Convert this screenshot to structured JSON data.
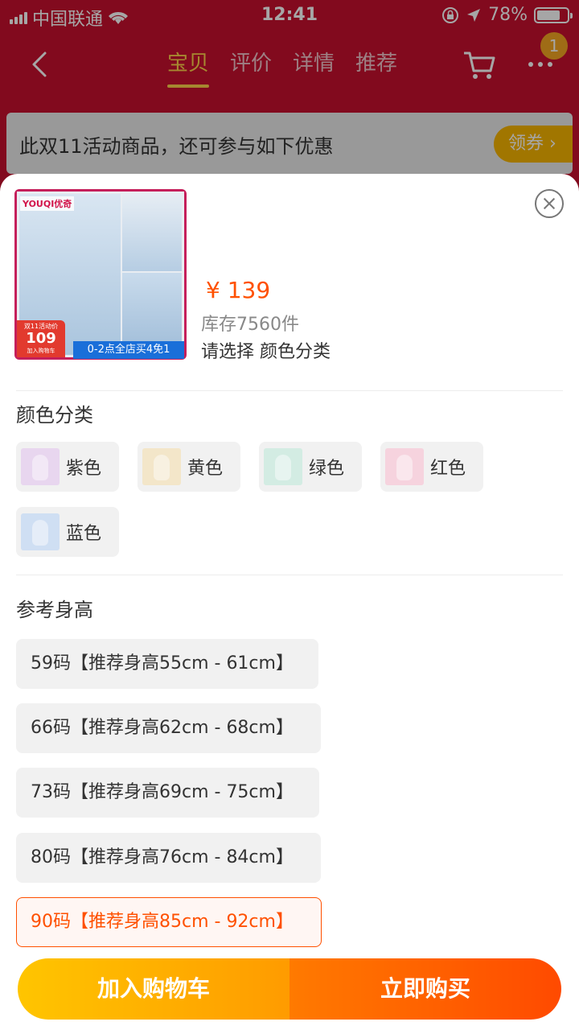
{
  "status": {
    "carrier": "中国联通",
    "time": "12:41",
    "battery": "78%"
  },
  "nav": {
    "tabs": [
      "宝贝",
      "评价",
      "详情",
      "推荐"
    ],
    "active_tab": "宝贝",
    "badge": "1"
  },
  "promo": {
    "text": "此双11活动商品，还可参与如下优惠",
    "coupon_label": "领券"
  },
  "product": {
    "price": "¥ 139",
    "stock": "库存7560件",
    "select_hint": "请选择 颜色分类",
    "thumb": {
      "brand": "YOUQI优奇",
      "tag_top": "双11活动价",
      "tag_price": "109",
      "tag_bottom": "加入购物车",
      "banner": "0-2点全店买4免1"
    }
  },
  "color_section": {
    "title": "颜色分类",
    "options": [
      {
        "label": "紫色",
        "swatch": "#e8d6ef"
      },
      {
        "label": "黄色",
        "swatch": "#f3e6c9"
      },
      {
        "label": "绿色",
        "swatch": "#d3ece3"
      },
      {
        "label": "红色",
        "swatch": "#f6d3de"
      },
      {
        "label": "蓝色",
        "swatch": "#cfdff3"
      }
    ]
  },
  "height_section": {
    "title": "参考身高",
    "options": [
      {
        "label": "59码【推荐身高55cm - 61cm】",
        "selected": false
      },
      {
        "label": "66码【推荐身高62cm - 68cm】",
        "selected": false
      },
      {
        "label": "73码【推荐身高69cm - 75cm】",
        "selected": false
      },
      {
        "label": "80码【推荐身高76cm - 84cm】",
        "selected": false
      },
      {
        "label": "90码【推荐身高85cm - 92cm】",
        "selected": true
      }
    ]
  },
  "actions": {
    "add_to_cart": "加入购物车",
    "buy_now": "立即购买"
  },
  "colors": {
    "accent": "#ff5000",
    "nav_bg": "#c8102e",
    "tab_active": "#ffd24a"
  }
}
